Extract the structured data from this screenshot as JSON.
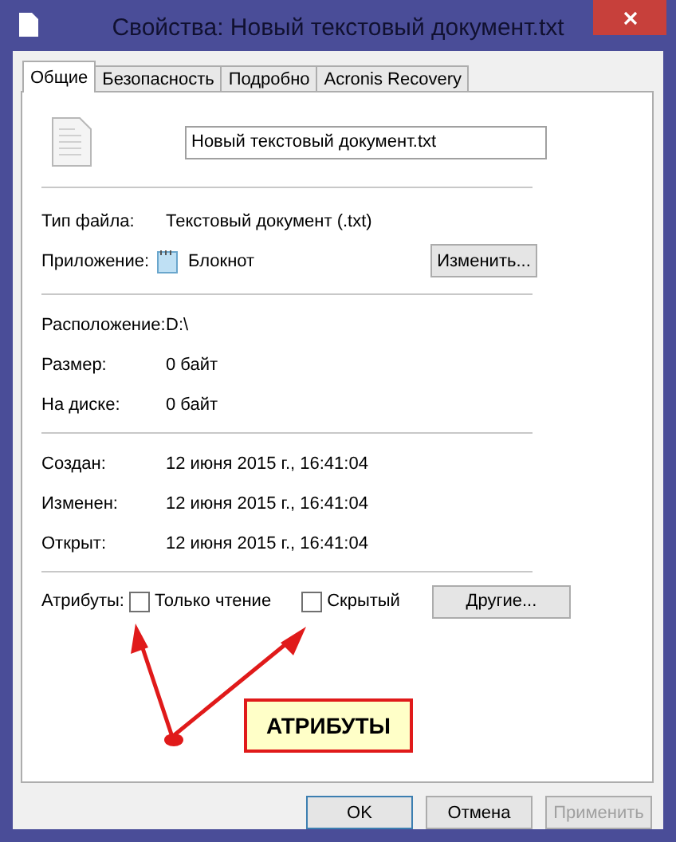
{
  "window": {
    "title": "Свойства: Новый текстовый документ.txt"
  },
  "tabs": [
    {
      "label": "Общие",
      "selected": true
    },
    {
      "label": "Безопасность",
      "selected": false
    },
    {
      "label": "Подробно",
      "selected": false
    },
    {
      "label": "Acronis Recovery",
      "selected": false
    }
  ],
  "file_name": "Новый текстовый документ.txt",
  "type_row": {
    "label": "Тип файла:",
    "value": "Текстовый документ (.txt)"
  },
  "app_row": {
    "label": "Приложение:",
    "value": "Блокнот",
    "button": "Изменить..."
  },
  "location_rows": [
    {
      "label": "Расположение:",
      "value": "D:\\"
    },
    {
      "label": "Размер:",
      "value": "0 байт"
    },
    {
      "label": "На диске:",
      "value": "0 байт"
    }
  ],
  "date_rows": [
    {
      "label": "Создан:",
      "value": "12 июня 2015 г., 16:41:04"
    },
    {
      "label": "Изменен:",
      "value": "12 июня 2015 г., 16:41:04"
    },
    {
      "label": "Открыт:",
      "value": "12 июня 2015 г., 16:41:04"
    }
  ],
  "attributes": {
    "label": "Атрибуты:",
    "checkboxes": [
      {
        "label": "Только чтение",
        "checked": false
      },
      {
        "label": "Скрытый",
        "checked": false
      }
    ],
    "button": "Другие..."
  },
  "annotation": {
    "text": "АТРИБУТЫ"
  },
  "buttons": [
    {
      "label": "OK",
      "default": true,
      "disabled": false
    },
    {
      "label": "Отмена",
      "default": false,
      "disabled": false
    },
    {
      "label": "Применить",
      "default": false,
      "disabled": true
    }
  ]
}
